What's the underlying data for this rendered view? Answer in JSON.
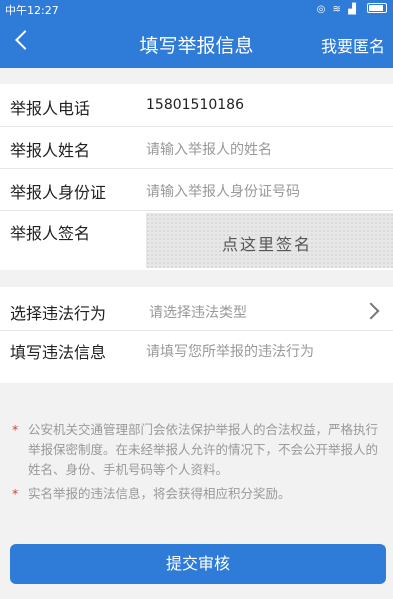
{
  "statusbar": {
    "time": "中午12:27"
  },
  "header": {
    "title": "填写举报信息",
    "anonymous": "我要匿名"
  },
  "form": {
    "phone": {
      "label": "举报人电话",
      "value": "15801510186"
    },
    "name": {
      "label": "举报人姓名",
      "placeholder": "请输入举报人的姓名"
    },
    "id": {
      "label": "举报人身份证",
      "placeholder": "请输入举报人身份证号码"
    },
    "sign": {
      "label": "举报人签名",
      "hint": "点这里签名"
    },
    "type": {
      "label": "选择违法行为",
      "placeholder": "请选择违法类型"
    },
    "info": {
      "label": "填写违法信息",
      "placeholder": "请填写您所举报的违法行为"
    }
  },
  "notes": {
    "star": "*",
    "items": [
      "公安机关交通管理部门会依法保护举报人的合法权益，严格执行举报保密制度。在未经举报人允许的情况下，不会公开举报人的姓名、身份、手机号码等个人资料。",
      "实名举报的违法信息，将会获得相应积分奖励。"
    ]
  },
  "submit": "提交审核"
}
